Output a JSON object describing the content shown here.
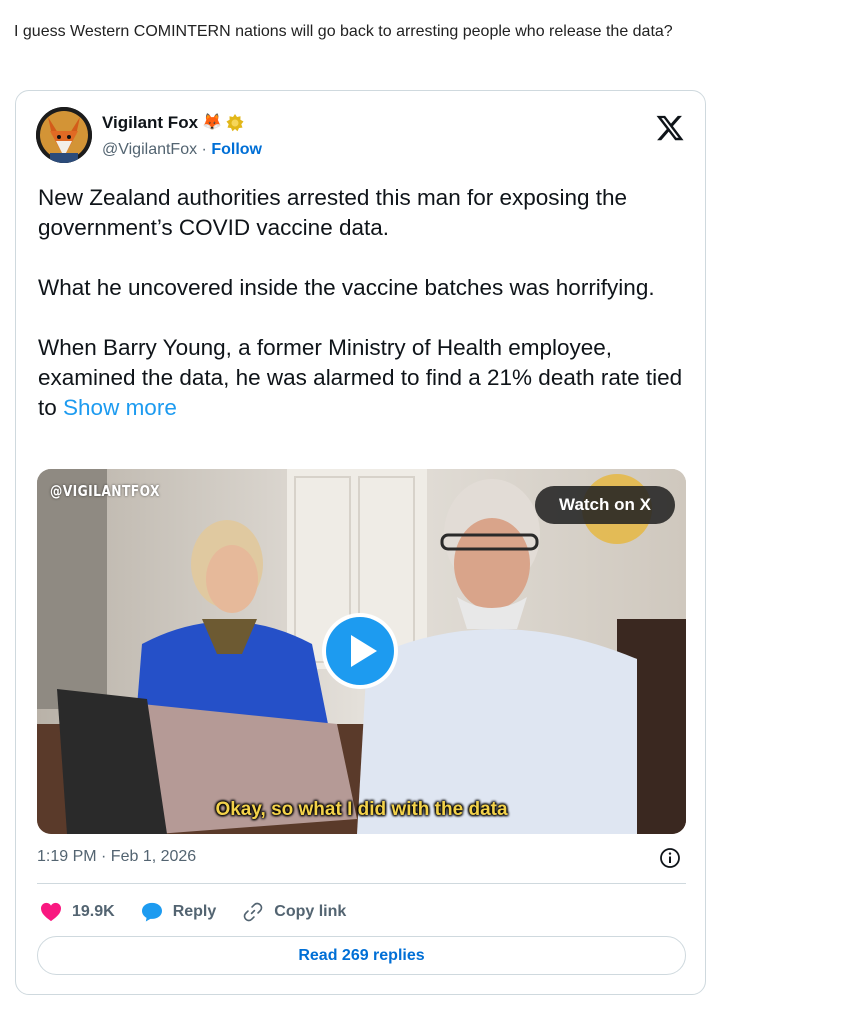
{
  "post": {
    "text": "I guess Western COMINTERN nations will go back to arresting people who release the data?"
  },
  "tweet": {
    "author_name": "Vigilant Fox",
    "author_emojis": [
      "fox-face-icon",
      "verified-gold-badge-icon"
    ],
    "handle": "@VigilantFox",
    "separator": " · ",
    "follow_label": "Follow",
    "paragraphs": [
      "New Zealand authorities arrested this man for exposing the government’s COVID vaccine data.",
      "What he uncovered inside the vaccine batches was horrifying."
    ],
    "last_paragraph": "When Barry Young, a former Ministry of Health employee, examined the data, he was alarmed to find a 21% death rate tied to ",
    "show_more_label": "Show more",
    "media": {
      "watermark": "@VIGILANTFOX",
      "watch_label": "Watch on X",
      "caption": "Okay, so what I did with the data"
    },
    "timestamp": "1:19 PM · Feb 1, 2026",
    "likes": "19.9K",
    "reply_label": "Reply",
    "copy_link_label": "Copy link",
    "read_replies_label": "Read 269 replies"
  },
  "colors": {
    "link": "#1d9bf0",
    "follow": "#006fd6",
    "like": "#f91880",
    "reply": "#1d9bf0",
    "caption": "#f3d24a"
  }
}
